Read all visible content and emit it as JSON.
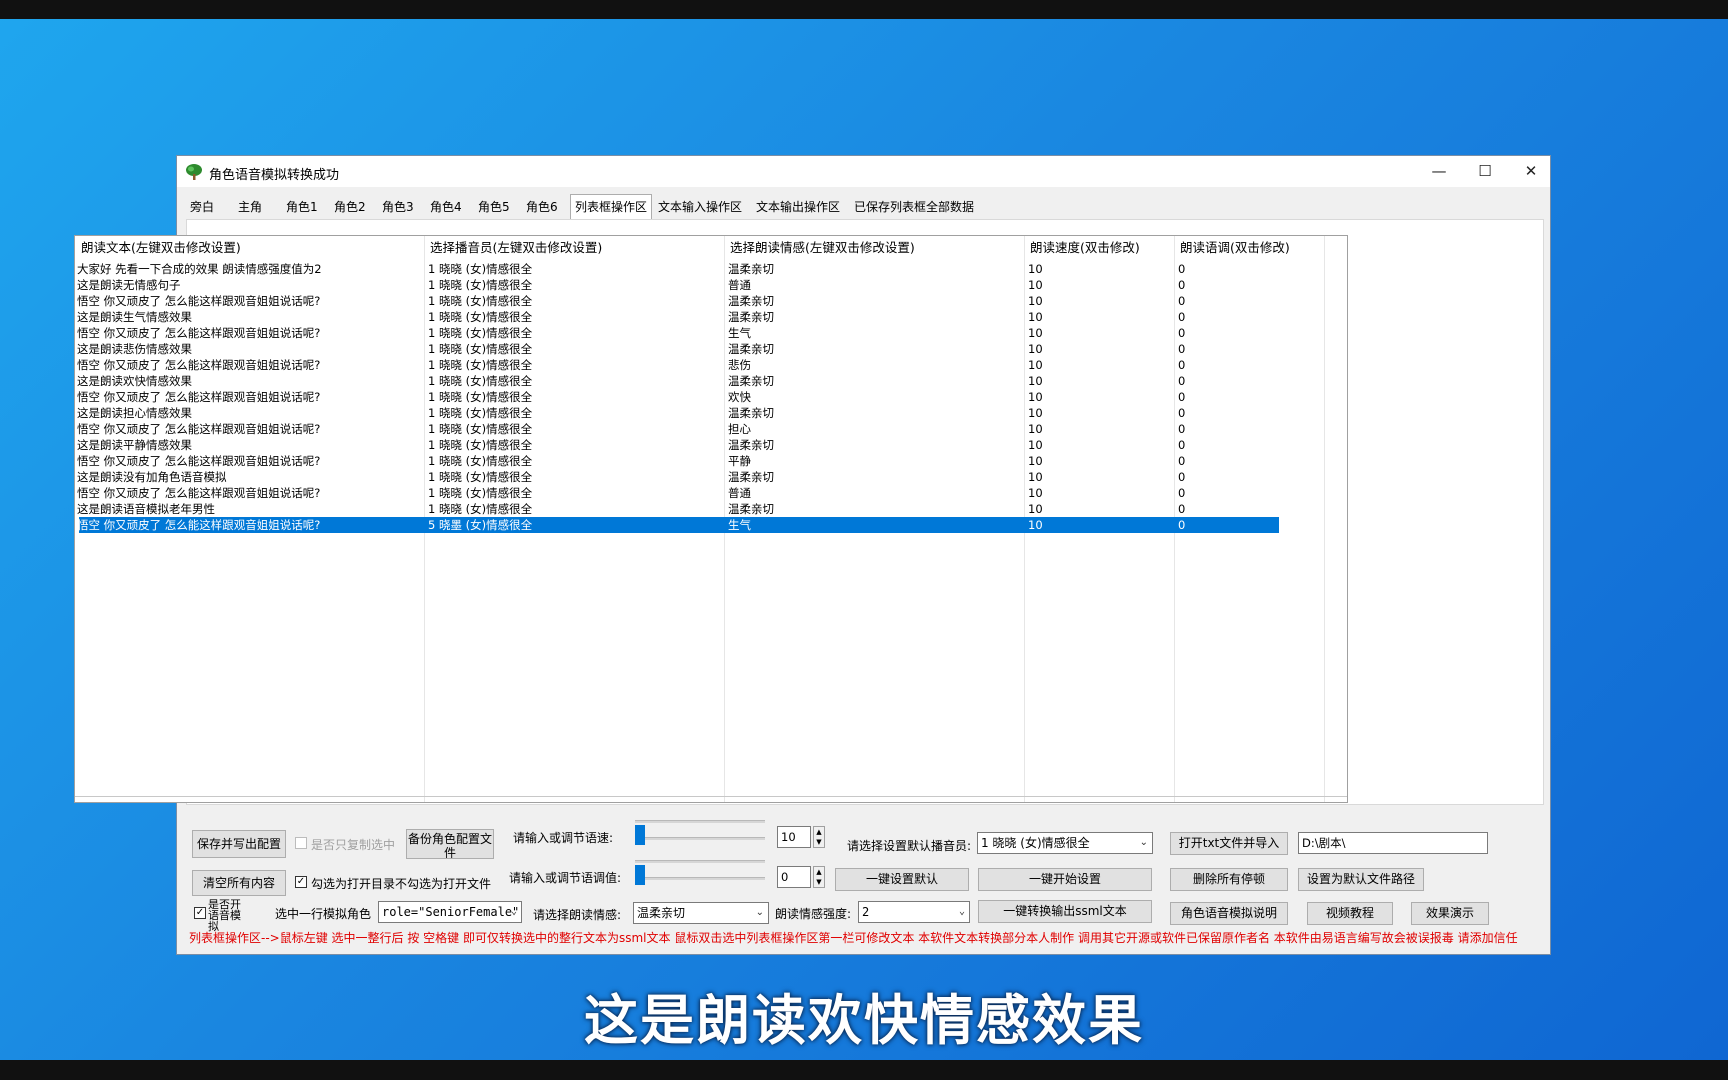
{
  "window": {
    "title": "角色语音模拟转换成功"
  },
  "subtitle": "这是朗读欢快情感效果",
  "tabs": [
    "旁白",
    "主角",
    "角色1",
    "角色2",
    "角色3",
    "角色4",
    "角色5",
    "角色6",
    "列表框操作区",
    "文本输入操作区",
    "文本输出操作区",
    "已保存列表框全部数据"
  ],
  "active_tab": "列表框操作区",
  "list": {
    "columns": [
      "朗读文本(左键双击修改设置)",
      "选择播音员(左键双击修改设置)",
      "选择朗读情感(左键双击修改设置)",
      "朗读速度(双击修改)",
      "朗读语调(双击修改)"
    ],
    "rows": [
      {
        "text": "大家好 先看一下合成的效果 朗读情感强度值为2",
        "voice": "1  晓晓 (女)情感很全",
        "emotion": "温柔亲切",
        "speed": "10",
        "pitch": "0"
      },
      {
        "text": "这是朗读无情感句子",
        "voice": "1  晓晓 (女)情感很全",
        "emotion": "普通",
        "speed": "10",
        "pitch": "0"
      },
      {
        "text": "悟空 你又顽皮了 怎么能这样跟观音姐姐说话呢?",
        "voice": "1  晓晓 (女)情感很全",
        "emotion": "温柔亲切",
        "speed": "10",
        "pitch": "0"
      },
      {
        "text": "这是朗读生气情感效果",
        "voice": "1  晓晓 (女)情感很全",
        "emotion": "温柔亲切",
        "speed": "10",
        "pitch": "0"
      },
      {
        "text": "悟空 你又顽皮了 怎么能这样跟观音姐姐说话呢?",
        "voice": "1  晓晓 (女)情感很全",
        "emotion": "生气",
        "speed": "10",
        "pitch": "0"
      },
      {
        "text": "这是朗读悲伤情感效果",
        "voice": "1  晓晓 (女)情感很全",
        "emotion": "温柔亲切",
        "speed": "10",
        "pitch": "0"
      },
      {
        "text": "悟空 你又顽皮了 怎么能这样跟观音姐姐说话呢?",
        "voice": "1  晓晓 (女)情感很全",
        "emotion": "悲伤",
        "speed": "10",
        "pitch": "0"
      },
      {
        "text": "这是朗读欢快情感效果",
        "voice": "1  晓晓 (女)情感很全",
        "emotion": "温柔亲切",
        "speed": "10",
        "pitch": "0"
      },
      {
        "text": "悟空 你又顽皮了 怎么能这样跟观音姐姐说话呢?",
        "voice": "1  晓晓 (女)情感很全",
        "emotion": "欢快",
        "speed": "10",
        "pitch": "0"
      },
      {
        "text": "这是朗读担心情感效果",
        "voice": "1  晓晓 (女)情感很全",
        "emotion": "温柔亲切",
        "speed": "10",
        "pitch": "0"
      },
      {
        "text": "悟空 你又顽皮了 怎么能这样跟观音姐姐说话呢?",
        "voice": "1  晓晓 (女)情感很全",
        "emotion": "担心",
        "speed": "10",
        "pitch": "0"
      },
      {
        "text": "这是朗读平静情感效果",
        "voice": "1  晓晓 (女)情感很全",
        "emotion": "温柔亲切",
        "speed": "10",
        "pitch": "0"
      },
      {
        "text": "悟空 你又顽皮了 怎么能这样跟观音姐姐说话呢?",
        "voice": "1  晓晓 (女)情感很全",
        "emotion": "平静",
        "speed": "10",
        "pitch": "0"
      },
      {
        "text": "这是朗读没有加角色语音模拟",
        "voice": "1  晓晓 (女)情感很全",
        "emotion": "温柔亲切",
        "speed": "10",
        "pitch": "0"
      },
      {
        "text": "悟空 你又顽皮了 怎么能这样跟观音姐姐说话呢?",
        "voice": "1  晓晓 (女)情感很全",
        "emotion": "普通",
        "speed": "10",
        "pitch": "0"
      },
      {
        "text": "这是朗读语音模拟老年男性",
        "voice": "1  晓晓 (女)情感很全",
        "emotion": "温柔亲切",
        "speed": "10",
        "pitch": "0"
      },
      {
        "text": "悟空 你又顽皮了 怎么能这样跟观音姐姐说话呢?",
        "voice": "5  晓墨 (女)情感很全",
        "emotion": "生气",
        "speed": "10",
        "pitch": "0"
      }
    ],
    "selected_index": 16
  },
  "controls": {
    "save_export_label": "保存并写出配置",
    "copy_selected_only_label": "是否只复制选中",
    "backup_config_label": "备份角色配置文件",
    "clear_all_label": "清空所有内容",
    "open_dir_label": "勾选为打开目录不勾选为打开文件",
    "enable_sim_label": "是否开语音模拟",
    "select_row_role_label": "选中一行模拟角色",
    "role_value": "role=\"SeniorFemale\"",
    "speed_label": "请输入或调节语速:",
    "speed_value": "10",
    "pitch_label": "请输入或调节语调值:",
    "pitch_value": "0",
    "emotion_label": "请选择朗读情感:",
    "emotion_value": "温柔亲切",
    "intensity_label": "朗读情感强度:",
    "intensity_value": "2",
    "default_voice_label": "请选择设置默认播音员:",
    "default_voice_value": "1  晓晓 (女)情感很全",
    "one_key_default_label": "一键设置默认",
    "one_key_start_label": "一键开始设置",
    "one_key_convert_label": "一键转换输出ssml文本",
    "open_txt_label": "打开txt文件并导入",
    "path_value": "D:\\剧本\\",
    "delete_pauses_label": "删除所有停顿",
    "set_default_path_label": "设置为默认文件路径",
    "role_help_label": "角色语音模拟说明",
    "video_tutorial_label": "视频教程",
    "demo_label": "效果演示",
    "status_text": "列表框操作区-->鼠标左键 选中一整行后 按 空格键 即可仅转换选中的整行文本为ssml文本  鼠标双击选中列表框操作区第一栏可修改文本  本软件文本转换部分本人制作  调用其它开源或软件已保留原作者名  本软件由易语言编写故会被误报毒  请添加信任"
  },
  "flags": {
    "open_dir_checked": true,
    "enable_sim_checked": true,
    "copy_selected_only_checked": false
  },
  "sliders": {
    "speed_fraction": 0.0,
    "pitch_fraction": 0.0
  },
  "colors": {
    "accent": "#0078d7",
    "status_text": "#e00000",
    "desktop": "#1a86e0"
  },
  "icons": {
    "app": "tree-icon",
    "minimize": "minimize-icon",
    "maximize": "maximize-icon",
    "close": "close-icon"
  }
}
